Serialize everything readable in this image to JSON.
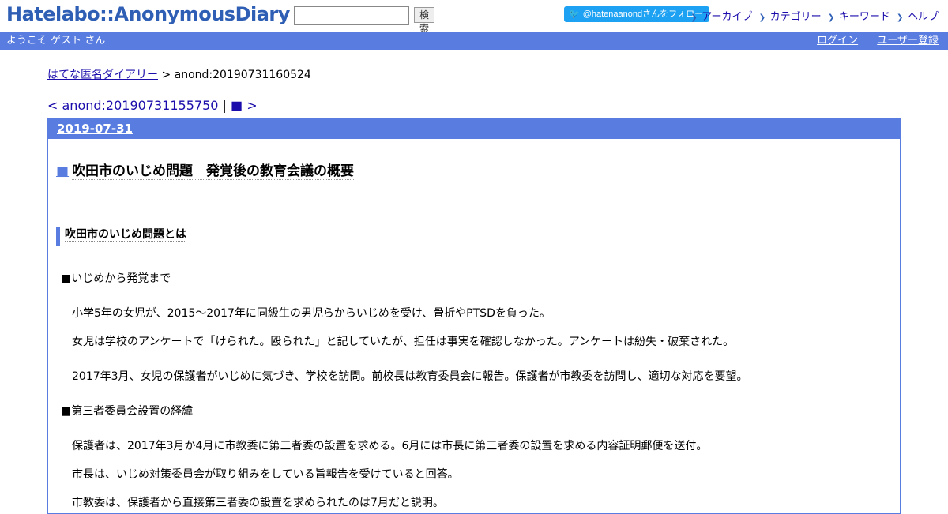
{
  "header": {
    "logo": "Hatelabo::AnonymousDiary",
    "search_button": "検索",
    "search_value": "",
    "follow_label": "@hatenaanondさんをフォロー",
    "nav": [
      "アーカイブ",
      "カテゴリー",
      "キーワード",
      "ヘルプ"
    ]
  },
  "bar": {
    "welcome": "ようこそ ゲスト さん",
    "login": "ログイン",
    "register": "ユーザー登録"
  },
  "breadcrumb": {
    "home": "はてな匿名ダイアリー",
    "sep": " > ",
    "current": "anond:20190731160524"
  },
  "pager": {
    "prev": "< anond:20190731155750",
    "sep": " | ",
    "next": "■ >"
  },
  "day": "2019-07-31",
  "entry": {
    "square": "■",
    "title": "吹田市のいじめ問題　発覚後の教育会議の概要",
    "h4": "吹田市のいじめ問題とは",
    "s1_head": "■いじめから発覚まで",
    "p1": "小学5年の女児が、2015～2017年に同級生の男児らからいじめを受け、骨折やPTSDを負った。",
    "p2": "女児は学校のアンケートで「けられた。殴られた」と記していたが、担任は事実を確認しなかった。アンケートは紛失・破棄された。",
    "p3": "2017年3月、女児の保護者がいじめに気づき、学校を訪問。前校長は教育委員会に報告。保護者が市教委を訪問し、適切な対応を要望。",
    "s2_head": "■第三者委員会設置の経緯",
    "p4": "保護者は、2017年3月か4月に市教委に第三者委の設置を求める。6月には市長に第三者委の設置を求める内容証明郵便を送付。",
    "p5": "市長は、いじめ対策委員会が取り組みをしている旨報告を受けていると回答。",
    "p6": "市教委は、保護者から直接第三者委の設置を求められたのは7月だと説明。"
  }
}
